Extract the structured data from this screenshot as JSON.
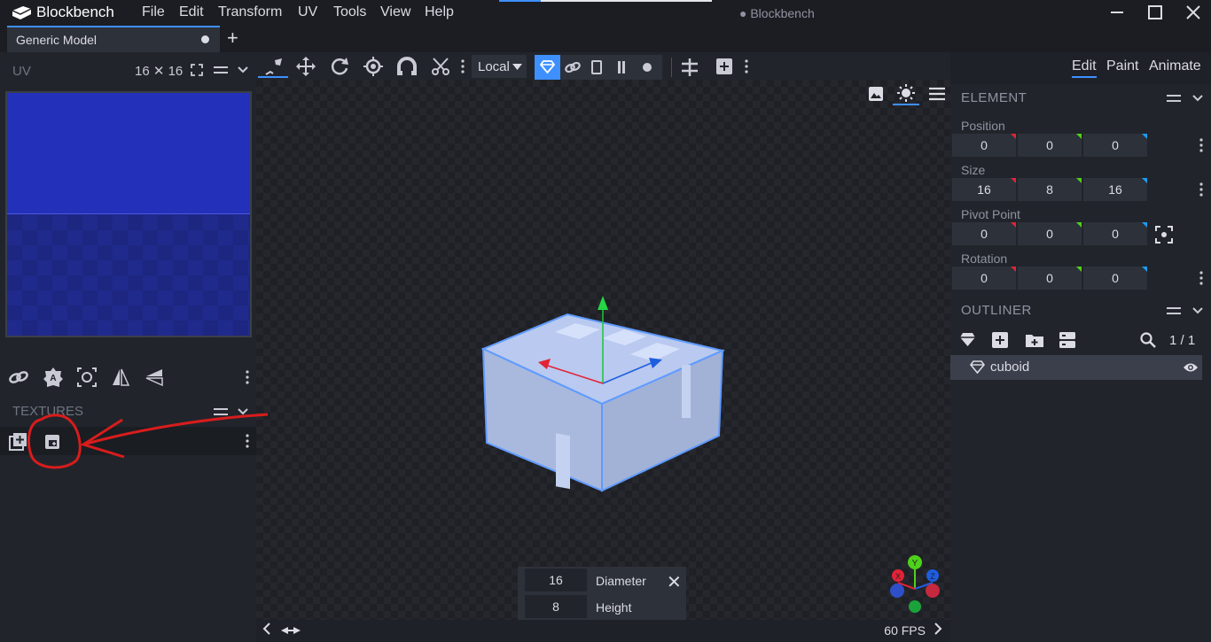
{
  "titlebar": {
    "app_name": "Blockbench",
    "window_title": "● Blockbench",
    "menus": [
      "File",
      "Edit",
      "Transform",
      "UV",
      "Tools",
      "View",
      "Help"
    ]
  },
  "tabs": {
    "model_tab": "Generic Model",
    "add_label": "+"
  },
  "uv_panel": {
    "title": "UV",
    "size": "16 ✕ 16"
  },
  "textures_panel": {
    "title": "TEXTURES"
  },
  "toolbar": {
    "space_select": "Local"
  },
  "viewport": {
    "fps": "60 FPS"
  },
  "shape_dialog": {
    "diameter_value": "16",
    "diameter_label": "Diameter",
    "height_value": "8",
    "height_label": "Height",
    "close_label": "✕"
  },
  "modes": {
    "edit": "Edit",
    "paint": "Paint",
    "animate": "Animate"
  },
  "element_panel": {
    "title": "ELEMENT",
    "position_label": "Position",
    "position": [
      "0",
      "0",
      "0"
    ],
    "size_label": "Size",
    "size": [
      "16",
      "8",
      "16"
    ],
    "pivot_label": "Pivot Point",
    "pivot": [
      "0",
      "0",
      "0"
    ],
    "rotation_label": "Rotation",
    "rotation": [
      "0",
      "0",
      "0"
    ]
  },
  "outliner": {
    "title": "OUTLINER",
    "count": "1 / 1",
    "items": [
      {
        "label": "cuboid"
      }
    ]
  },
  "axis_gizmo": {
    "x": "X",
    "y": "Y",
    "z": "Z"
  },
  "colors": {
    "accent": "#3e90ff",
    "x_axis": "#e32236",
    "y_axis": "#4ed21a",
    "z_axis": "#1e9bf0",
    "annotation": "#d81c1c"
  },
  "icons": [
    "blockbench-logo",
    "minimize-icon",
    "maximize-icon",
    "close-icon",
    "move-tool-icon",
    "resize-tool-icon",
    "rotate-tool-icon",
    "pivot-tool-icon",
    "vertex-snap-icon",
    "cut-icon",
    "gem-icon",
    "link-icon",
    "search-icon",
    "eye-icon"
  ]
}
